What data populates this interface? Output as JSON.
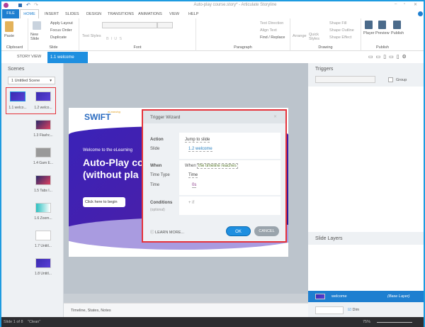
{
  "window": {
    "title": "Auto-play course.story* - Articulate Storyline"
  },
  "tabs": [
    "FILE",
    "HOME",
    "INSERT",
    "SLIDES",
    "DESIGN",
    "TRANSITIONS",
    "ANIMATIONS",
    "VIEW",
    "HELP"
  ],
  "ribbon": {
    "clipboard": {
      "label": "Clipboard",
      "paste": "Paste"
    },
    "slide": {
      "label": "Slide",
      "new_slide": "New Slide",
      "apply_layout": "Apply Layout",
      "focus_order": "Focus Order",
      "duplicate": "Duplicate"
    },
    "font": {
      "label": "Font",
      "text_styles": "Text Styles"
    },
    "paragraph": {
      "label": "Paragraph",
      "text_direction": "Text Direction",
      "align_text": "Align Text",
      "find_replace": "Find / Replace"
    },
    "drawing": {
      "label": "Drawing",
      "arrange": "Arrange",
      "quick_styles": "Quick Styles",
      "shape_fill": "Shape Fill",
      "shape_outline": "Shape Outline",
      "shape_effect": "Shape Effect"
    },
    "publish": {
      "label": "Publish",
      "player": "Player",
      "preview": "Preview",
      "publish": "Publish"
    }
  },
  "doc_tabs": {
    "story_view": "STORY VIEW",
    "active": "1.1 welcome"
  },
  "scenes": {
    "title": "Scenes",
    "selected_scene": "1 Untitled Scene",
    "slides": [
      "1.1 welco...",
      "1.2 welco...",
      "1.3 Flashc...",
      "1.4 Gam E...",
      "1.5 Tabs I...",
      "1.6 Zoom...",
      "1.7 Untitl...",
      "1.8 Untitl..."
    ]
  },
  "slide": {
    "logo": "SWIFT",
    "logo_sub": "eLearning",
    "welcome": "Welcome to the eLearning",
    "heading1": "Auto-Play co",
    "heading2": "(without pla",
    "button": "Click here to begin"
  },
  "dialog": {
    "title": "Trigger Wizard",
    "action_label": "Action",
    "action_value": "Jump to slide",
    "slide_label": "Slide",
    "slide_value": "1.2 welcome",
    "when_label": "When",
    "when_prefix": "When",
    "when_value": "the timeline reaches",
    "time_type_label": "Time Type",
    "time_type_value": "Time",
    "time_label": "Time",
    "time_value": "0s",
    "conditions_label": "Conditions",
    "conditions_optional": "(optional)",
    "add_if": "+ if",
    "learn_more": "LEARN MORE...",
    "ok": "OK",
    "cancel": "CANCEL"
  },
  "triggers": {
    "title": "Triggers",
    "group": "Group"
  },
  "layers": {
    "title": "Slide Layers",
    "layer_name": "welcome",
    "layer_type": "(Base Layer)",
    "dim": "Dim"
  },
  "timeline": {
    "label": "Timeline, States, Notes"
  },
  "status": {
    "slide": "Slide 1 of 8",
    "theme": "\"Clean\"",
    "zoom": "75%"
  },
  "colors": {
    "accent": "#1e9be0",
    "highlight": "#e5333b",
    "ok": "#1e8fe0"
  }
}
